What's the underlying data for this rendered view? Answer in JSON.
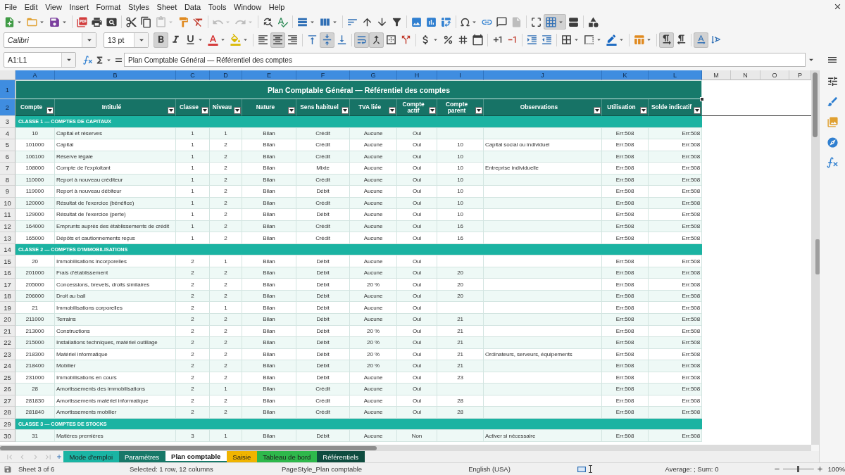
{
  "menu_bar": {
    "items": [
      "File",
      "Edit",
      "View",
      "Insert",
      "Format",
      "Styles",
      "Sheet",
      "Data",
      "Tools",
      "Window",
      "Help"
    ]
  },
  "standard_toolbar": {
    "paste_disabled": true,
    "undo_disabled": true,
    "redo_disabled": true,
    "headers_footers_disabled": true,
    "freeze_pressed": true
  },
  "formatting_toolbar": {
    "font_name": "Calibri",
    "font_size": "13 pt",
    "bold_pressed": true,
    "italic_pressed": false,
    "underline_pressed": false,
    "align_left_pressed": false,
    "align_center_pressed": true,
    "align_right_pressed": false,
    "align_top_pressed": false,
    "align_middle_pressed": true,
    "align_bottom_pressed": false,
    "wrap_pressed": true,
    "merge_center_pressed": true,
    "left_to_right_pressed": true,
    "right_to_left_pressed": false,
    "horizontal_text_pressed": true,
    "vertical_text_pressed": false
  },
  "formula_bar": {
    "name_box": "A1:L1",
    "formula": "Plan Comptable Général — Référentiel des comptes"
  },
  "sheet": {
    "columns": [
      {
        "letter": "A",
        "selected": true
      },
      {
        "letter": "B",
        "selected": true
      },
      {
        "letter": "C",
        "selected": true
      },
      {
        "letter": "D",
        "selected": true
      },
      {
        "letter": "E",
        "selected": true
      },
      {
        "letter": "F",
        "selected": true
      },
      {
        "letter": "G",
        "selected": true
      },
      {
        "letter": "H",
        "selected": true
      },
      {
        "letter": "I",
        "selected": true
      },
      {
        "letter": "J",
        "selected": true
      },
      {
        "letter": "K",
        "selected": true
      },
      {
        "letter": "L",
        "selected": true
      },
      {
        "letter": "M",
        "selected": false
      },
      {
        "letter": "N",
        "selected": false
      },
      {
        "letter": "O",
        "selected": false
      },
      {
        "letter": "P",
        "selected": false
      }
    ],
    "rows": [
      {
        "number": "1",
        "selected": true,
        "kind": "title",
        "title": "Plan Comptable Général — Référentiel des comptes"
      },
      {
        "number": "2",
        "selected": true,
        "kind": "header",
        "cells": [
          {
            "text": "Compte",
            "filter": true
          },
          {
            "text": "Intitulé",
            "filter": true
          },
          {
            "text": "Classe",
            "filter": true
          },
          {
            "text": "Niveau",
            "filter": true
          },
          {
            "text": "Nature",
            "filter": true
          },
          {
            "text": "Sens habituel",
            "filter": true
          },
          {
            "text": "TVA liée",
            "filter": true
          },
          {
            "text": "Compte actif",
            "filter": true
          },
          {
            "text": "Compte parent",
            "filter": true
          },
          {
            "text": "Observations",
            "filter": true
          },
          {
            "text": "Utilisation",
            "filter": true
          },
          {
            "text": "Solde indicatif",
            "filter": true
          }
        ]
      },
      {
        "number": "3",
        "selected": false,
        "kind": "section",
        "heading": "CLASSE 1 — COMPTES DE CAPITAUX"
      },
      {
        "number": "4",
        "selected": false,
        "kind": "account",
        "compte": "10",
        "intitule": "Capital et réserves",
        "classe": "1",
        "niveau": "1",
        "nature": "Bilan",
        "sens": "Crédit",
        "tva": "Aucune",
        "actif": "Oui",
        "utilisation": "Err:508",
        "solde": "Err:508"
      },
      {
        "number": "5",
        "selected": false,
        "kind": "account",
        "compte": "101000",
        "intitule": "Capital",
        "classe": "1",
        "niveau": "2",
        "nature": "Bilan",
        "sens": "Crédit",
        "tva": "Aucune",
        "actif": "Oui",
        "parent": "10",
        "observations": "Capital social ou individuel",
        "utilisation": "Err:508",
        "solde": "Err:508"
      },
      {
        "number": "6",
        "selected": false,
        "kind": "account",
        "compte": "106100",
        "intitule": "Réserve légale",
        "classe": "1",
        "niveau": "2",
        "nature": "Bilan",
        "sens": "Crédit",
        "tva": "Aucune",
        "actif": "Oui",
        "parent": "10",
        "utilisation": "Err:508",
        "solde": "Err:508"
      },
      {
        "number": "7",
        "selected": false,
        "kind": "account",
        "compte": "108000",
        "intitule": "Compte de l'exploitant",
        "classe": "1",
        "niveau": "2",
        "nature": "Bilan",
        "sens": "Mixte",
        "tva": "Aucune",
        "actif": "Oui",
        "parent": "10",
        "observations": "Entreprise individuelle",
        "utilisation": "Err:508",
        "solde": "Err:508"
      },
      {
        "number": "8",
        "selected": false,
        "kind": "account",
        "compte": "110000",
        "intitule": "Report à nouveau créditeur",
        "classe": "1",
        "niveau": "2",
        "nature": "Bilan",
        "sens": "Crédit",
        "tva": "Aucune",
        "actif": "Oui",
        "parent": "10",
        "utilisation": "Err:508",
        "solde": "Err:508"
      },
      {
        "number": "9",
        "selected": false,
        "kind": "account",
        "compte": "119000",
        "intitule": "Report à nouveau débiteur",
        "classe": "1",
        "niveau": "2",
        "nature": "Bilan",
        "sens": "Débit",
        "tva": "Aucune",
        "actif": "Oui",
        "parent": "10",
        "utilisation": "Err:508",
        "solde": "Err:508"
      },
      {
        "number": "10",
        "selected": false,
        "kind": "account",
        "compte": "120000",
        "intitule": "Résultat de l'exercice (bénéfice)",
        "classe": "1",
        "niveau": "2",
        "nature": "Bilan",
        "sens": "Crédit",
        "tva": "Aucune",
        "actif": "Oui",
        "parent": "10",
        "utilisation": "Err:508",
        "solde": "Err:508"
      },
      {
        "number": "11",
        "selected": false,
        "kind": "account",
        "compte": "129000",
        "intitule": "Résultat de l'exercice (perte)",
        "classe": "1",
        "niveau": "2",
        "nature": "Bilan",
        "sens": "Débit",
        "tva": "Aucune",
        "actif": "Oui",
        "parent": "10",
        "utilisation": "Err:508",
        "solde": "Err:508"
      },
      {
        "number": "12",
        "selected": false,
        "kind": "account",
        "compte": "164000",
        "intitule": "Emprunts auprès des établissements de crédit",
        "classe": "1",
        "niveau": "2",
        "nature": "Bilan",
        "sens": "Crédit",
        "tva": "Aucune",
        "actif": "Oui",
        "parent": "16",
        "utilisation": "Err:508",
        "solde": "Err:508"
      },
      {
        "number": "13",
        "selected": false,
        "kind": "account",
        "compte": "165000",
        "intitule": "Dépôts et cautionnements reçus",
        "classe": "1",
        "niveau": "2",
        "nature": "Bilan",
        "sens": "Crédit",
        "tva": "Aucune",
        "actif": "Oui",
        "parent": "16",
        "utilisation": "Err:508",
        "solde": "Err:508"
      },
      {
        "number": "14",
        "selected": false,
        "kind": "section",
        "heading": "CLASSE 2 — COMPTES D'IMMOBILISATIONS"
      },
      {
        "number": "15",
        "selected": false,
        "kind": "account",
        "compte": "20",
        "intitule": "Immobilisations incorporelles",
        "classe": "2",
        "niveau": "1",
        "nature": "Bilan",
        "sens": "Débit",
        "tva": "Aucune",
        "actif": "Oui",
        "utilisation": "Err:508",
        "solde": "Err:508"
      },
      {
        "number": "16",
        "selected": false,
        "kind": "account",
        "compte": "201000",
        "intitule": "Frais d'établissement",
        "classe": "2",
        "niveau": "2",
        "nature": "Bilan",
        "sens": "Débit",
        "tva": "Aucune",
        "actif": "Oui",
        "parent": "20",
        "utilisation": "Err:508",
        "solde": "Err:508"
      },
      {
        "number": "17",
        "selected": false,
        "kind": "account",
        "compte": "205000",
        "intitule": "Concessions, brevets, droits similaires",
        "classe": "2",
        "niveau": "2",
        "nature": "Bilan",
        "sens": "Débit",
        "tva": "20 %",
        "actif": "Oui",
        "parent": "20",
        "utilisation": "Err:508",
        "solde": "Err:508"
      },
      {
        "number": "18",
        "selected": false,
        "kind": "account",
        "compte": "206000",
        "intitule": "Droit au bail",
        "classe": "2",
        "niveau": "2",
        "nature": "Bilan",
        "sens": "Débit",
        "tva": "Aucune",
        "actif": "Oui",
        "parent": "20",
        "utilisation": "Err:508",
        "solde": "Err:508"
      },
      {
        "number": "19",
        "selected": false,
        "kind": "account",
        "compte": "21",
        "intitule": "Immobilisations corporelles",
        "classe": "2",
        "niveau": "1",
        "nature": "Bilan",
        "sens": "Débit",
        "tva": "Aucune",
        "actif": "Oui",
        "utilisation": "Err:508",
        "solde": "Err:508"
      },
      {
        "number": "20",
        "selected": false,
        "kind": "account",
        "compte": "211000",
        "intitule": "Terrains",
        "classe": "2",
        "niveau": "2",
        "nature": "Bilan",
        "sens": "Débit",
        "tva": "Aucune",
        "actif": "Oui",
        "parent": "21",
        "utilisation": "Err:508",
        "solde": "Err:508"
      },
      {
        "number": "21",
        "selected": false,
        "kind": "account",
        "compte": "213000",
        "intitule": "Constructions",
        "classe": "2",
        "niveau": "2",
        "nature": "Bilan",
        "sens": "Débit",
        "tva": "20 %",
        "actif": "Oui",
        "parent": "21",
        "utilisation": "Err:508",
        "solde": "Err:508"
      },
      {
        "number": "22",
        "selected": false,
        "kind": "account",
        "compte": "215000",
        "intitule": "Installations techniques, matériel outillage",
        "classe": "2",
        "niveau": "2",
        "nature": "Bilan",
        "sens": "Débit",
        "tva": "20 %",
        "actif": "Oui",
        "parent": "21",
        "utilisation": "Err:508",
        "solde": "Err:508"
      },
      {
        "number": "23",
        "selected": false,
        "kind": "account",
        "compte": "218300",
        "intitule": "Matériel informatique",
        "classe": "2",
        "niveau": "2",
        "nature": "Bilan",
        "sens": "Débit",
        "tva": "20 %",
        "actif": "Oui",
        "parent": "21",
        "observations": "Ordinateurs, serveurs, équipements",
        "utilisation": "Err:508",
        "solde": "Err:508"
      },
      {
        "number": "24",
        "selected": false,
        "kind": "account",
        "compte": "218400",
        "intitule": "Mobilier",
        "classe": "2",
        "niveau": "2",
        "nature": "Bilan",
        "sens": "Débit",
        "tva": "20 %",
        "actif": "Oui",
        "parent": "21",
        "utilisation": "Err:508",
        "solde": "Err:508"
      },
      {
        "number": "25",
        "selected": false,
        "kind": "account",
        "compte": "231000",
        "intitule": "Immobilisations en cours",
        "classe": "2",
        "niveau": "2",
        "nature": "Bilan",
        "sens": "Débit",
        "tva": "Aucune",
        "actif": "Oui",
        "parent": "23",
        "utilisation": "Err:508",
        "solde": "Err:508"
      },
      {
        "number": "26",
        "selected": false,
        "kind": "account",
        "compte": "28",
        "intitule": "Amortissements des immobilisations",
        "classe": "2",
        "niveau": "1",
        "nature": "Bilan",
        "sens": "Crédit",
        "tva": "Aucune",
        "actif": "Oui",
        "utilisation": "Err:508",
        "solde": "Err:508"
      },
      {
        "number": "27",
        "selected": false,
        "kind": "account",
        "compte": "281830",
        "intitule": "Amortissements matériel informatique",
        "classe": "2",
        "niveau": "2",
        "nature": "Bilan",
        "sens": "Crédit",
        "tva": "Aucune",
        "actif": "Oui",
        "parent": "28",
        "utilisation": "Err:508",
        "solde": "Err:508"
      },
      {
        "number": "28",
        "selected": false,
        "kind": "account",
        "compte": "281840",
        "intitule": "Amortissements mobilier",
        "classe": "2",
        "niveau": "2",
        "nature": "Bilan",
        "sens": "Crédit",
        "tva": "Aucune",
        "actif": "Oui",
        "parent": "28",
        "utilisation": "Err:508",
        "solde": "Err:508"
      },
      {
        "number": "29",
        "selected": false,
        "kind": "section",
        "heading": "CLASSE 3 — COMPTES DE STOCKS"
      },
      {
        "number": "30",
        "selected": false,
        "kind": "account",
        "compte": "31",
        "intitule": "Matières premières",
        "classe": "3",
        "niveau": "1",
        "nature": "Bilan",
        "sens": "Débit",
        "tva": "Aucune",
        "actif": "Non",
        "observations": "Activer si nécessaire",
        "utilisation": "Err:508",
        "solde": "Err:508"
      }
    ]
  },
  "sheet_tabs": {
    "navigation_disabled": true,
    "tabs": [
      {
        "label": "Mode d'emploi",
        "selected": false,
        "color": "#1ab4a3"
      },
      {
        "label": "Paramètres",
        "selected": false,
        "color": "#177868"
      },
      {
        "label": "Plan comptable",
        "selected": true
      },
      {
        "label": "Saisie",
        "selected": false,
        "color": "#f0b400"
      },
      {
        "label": "Tableau de bord",
        "selected": false,
        "color": "#2eb84b"
      },
      {
        "label": "Référentiels",
        "selected": false,
        "color": "#0e4c3f"
      }
    ]
  },
  "status_bar": {
    "sheet": "Sheet 3 of 6",
    "selection": "Selected: 1 row, 12 columns",
    "page_style": "PageStyle_Plan comptable",
    "language": "English (USA)",
    "summary": "Average: ; Sum: 0",
    "zoom": {
      "level": 0.5,
      "label": "100%"
    }
  }
}
